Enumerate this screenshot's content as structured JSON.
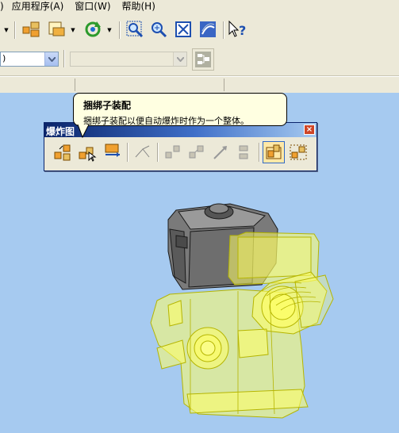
{
  "menubar": {
    "frag": ")",
    "items": [
      "应用程序(A)",
      "窗口(W)",
      "帮助(H)"
    ]
  },
  "toolbar2": {
    "combo1_value": ")",
    "combo2_value": ""
  },
  "panel": {
    "title": "爆炸图",
    "close_label": "×"
  },
  "tooltip": {
    "title": "捆绑子装配",
    "text": "捆绑子装配以便自动爆炸时作为一个整体。"
  },
  "colors": {
    "viewport_bg": "#a6caf0",
    "model_yellow": "#ffff00",
    "model_gray": "#707070",
    "title_blue": "#0a246a"
  },
  "icons": {
    "panel_buttons": [
      "explode-icon",
      "explode-step-icon",
      "move-component-icon",
      "trace-line-icon",
      "edit-explode-icon",
      "scatter-icon",
      "direction-icon",
      "rearrange-icon",
      "bind-subassembly-icon",
      "unbind-subassembly-icon"
    ],
    "toolbar_buttons": [
      "dropdown-arrow-icon",
      "assembly-icon",
      "component-icon",
      "refresh-icon",
      "zoom-window-icon",
      "zoom-icon",
      "fit-view-icon",
      "render-style-icon",
      "help-cursor-icon"
    ]
  }
}
